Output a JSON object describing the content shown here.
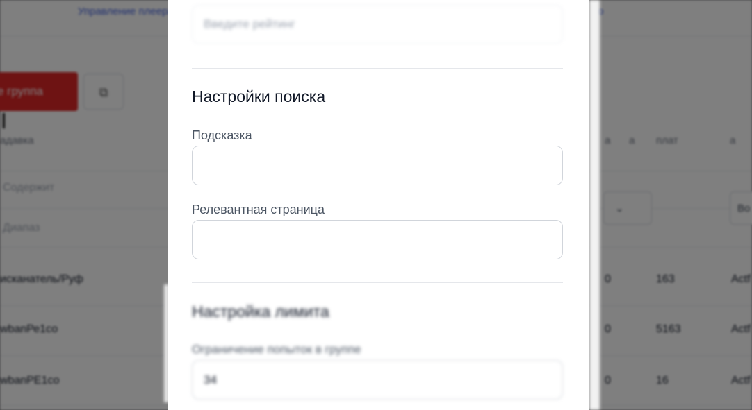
{
  "background": {
    "top_link_left": "Управление плеерами",
    "top_link_right": "о",
    "red_button_label": "е группа",
    "square_button_icon": "copy-icon",
    "column_headers": [
      "адавка",
      "а",
      "a",
      "плат",
      "a"
    ],
    "filter_row": [
      "Содержит",
      "Диапаз"
    ],
    "rows": [
      {
        "name": "исканатель/Руф",
        "a": "0",
        "b": "163",
        "c": "Actf"
      },
      {
        "name": "wbanРе1со",
        "a": "0",
        "b": "5163",
        "c": "Actf"
      },
      {
        "name": "wbanPЕ1со",
        "a": "0",
        "b": "16",
        "c": "Actf"
      }
    ],
    "select_right_1": "",
    "select_right_2": "Во"
  },
  "modal": {
    "top_input": {
      "label": "",
      "placeholder": "Введите рейтинг"
    },
    "search_settings": {
      "title": "Настройки поиска",
      "hint_label": "Подсказка",
      "hint_value": "",
      "relevant_page_label": "Релевантная страница",
      "relevant_page_value": ""
    },
    "limit_settings": {
      "title": "Настройка лимита",
      "limit_label": "Ограничение попыток в группе",
      "limit_value": "34"
    }
  }
}
